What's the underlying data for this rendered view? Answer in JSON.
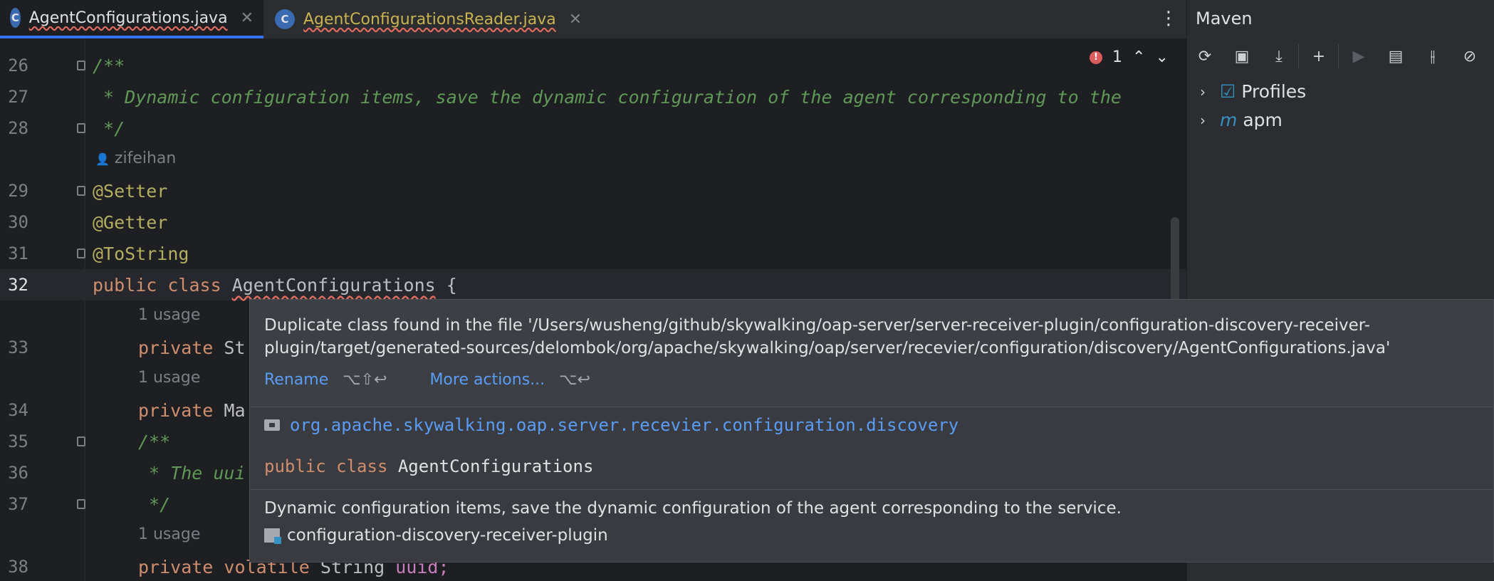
{
  "tabs": [
    {
      "label": "AgentConfigurations.java",
      "icon": "C"
    },
    {
      "label": "AgentConfigurationsReader.java",
      "icon": "C"
    }
  ],
  "inspection": {
    "error_count": "1"
  },
  "editor": {
    "lines": [
      {
        "num": "26",
        "text": "/**"
      },
      {
        "num": "27",
        "text": " * Dynamic configuration items, save the dynamic configuration of the agent corresponding to the"
      },
      {
        "num": "28",
        "text": " */"
      },
      {
        "author": "zifeihan"
      },
      {
        "num": "29",
        "text": "@Setter"
      },
      {
        "num": "30",
        "text": "@Getter"
      },
      {
        "num": "31",
        "text": "@ToString"
      },
      {
        "num": "32",
        "kw1": "public",
        "kw2": "class",
        "cls": "AgentConfigurations",
        "brace": "{"
      },
      {
        "usage": "1 usage"
      },
      {
        "num": "33",
        "kw": "private",
        "rest": "St"
      },
      {
        "usage": "1 usage"
      },
      {
        "num": "34",
        "kw": "private",
        "rest": "Ma"
      },
      {
        "num": "35",
        "text": "/**"
      },
      {
        "num": "36",
        "text": " * The uui"
      },
      {
        "num": "37",
        "text": " */"
      },
      {
        "usage": "1 usage"
      },
      {
        "num": "38",
        "kw": "private",
        "kw2": "volatile",
        "rest": "String",
        "var": "uuid;"
      }
    ]
  },
  "maven": {
    "title": "Maven",
    "items": [
      {
        "label": "Profiles"
      },
      {
        "label": "apm"
      }
    ]
  },
  "popup": {
    "message": "Duplicate class found in the file '/Users/wusheng/github/skywalking/oap-server/server-receiver-plugin/configuration-discovery-receiver-plugin/target/generated-sources/delombok/org/apache/skywalking/oap/server/recevier/configuration/discovery/AgentConfigurations.java'",
    "rename_label": "Rename",
    "rename_shortcut": "⌥⇧↩",
    "more_label": "More actions...",
    "more_shortcut": "⌥↩",
    "package": "org.apache.skywalking.oap.server.recevier.configuration.discovery",
    "decl_kw1": "public",
    "decl_kw2": "class",
    "decl_name": "AgentConfigurations",
    "doc": "Dynamic configuration items, save the dynamic configuration of the agent corresponding to the service.",
    "module": "configuration-discovery-receiver-plugin"
  },
  "colors": {
    "accent": "#3574f0",
    "link": "#5a9cf5",
    "error": "#db5c5c",
    "comment": "#5f9857",
    "keyword": "#cf8e6d",
    "annotation": "#b3ae60"
  }
}
